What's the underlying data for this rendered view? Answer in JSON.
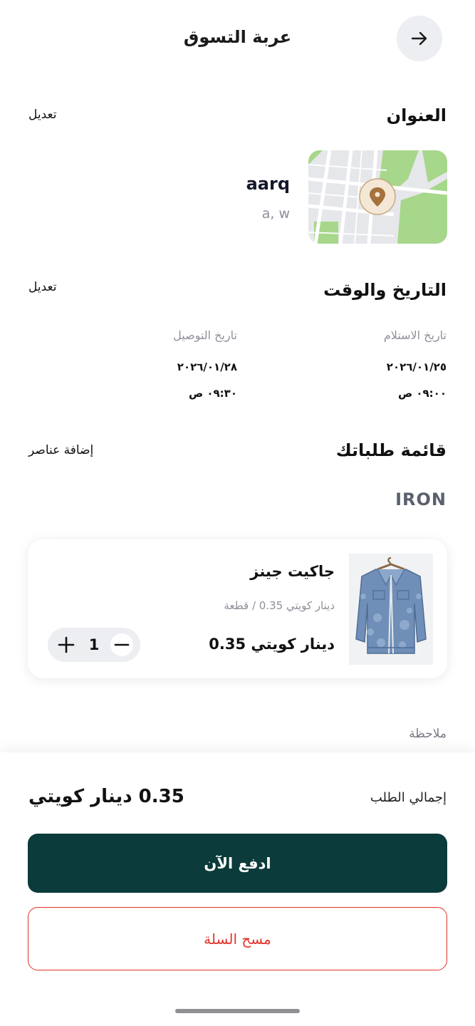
{
  "header": {
    "title": "عربة التسوق",
    "back_icon": "arrow-right-icon"
  },
  "address": {
    "section_title": "العنوان",
    "edit_label": "تعديل",
    "name": "aarq",
    "detail": "a, w",
    "map_icon": "map-pin-icon"
  },
  "datetime": {
    "section_title": "التاريخ والوقت",
    "edit_label": "تعديل",
    "pickup": {
      "label": "تاريخ الاستلام",
      "date": "٢٠٢٦/٠١/٢٥",
      "time": "٠٩:٠٠ ص"
    },
    "delivery": {
      "label": "تاريخ التوصيل",
      "date": "٢٠٢٦/٠١/٢٨",
      "time": "٠٩:٣٠ ص"
    }
  },
  "orders": {
    "section_title": "قائمة طلباتك",
    "add_label": "إضافة عناصر",
    "category": "IRON",
    "items": [
      {
        "name": "جاكيت جينز",
        "unit_price": "دينار كويتي 0.35 / قطعة",
        "price": "دينار كويتي  0.35",
        "quantity": "1"
      }
    ]
  },
  "note": {
    "label": "ملاحظة"
  },
  "summary": {
    "total_label": "إجمالي الطلب",
    "total_value": "0.35 دينار كويتي",
    "pay_label": "ادفع الآن",
    "clear_label": "مسح السلة"
  },
  "colors": {
    "primary": "#0b3b3a",
    "danger": "#e3332a",
    "muted": "#8d9099",
    "map_green": "#a6d78a"
  }
}
